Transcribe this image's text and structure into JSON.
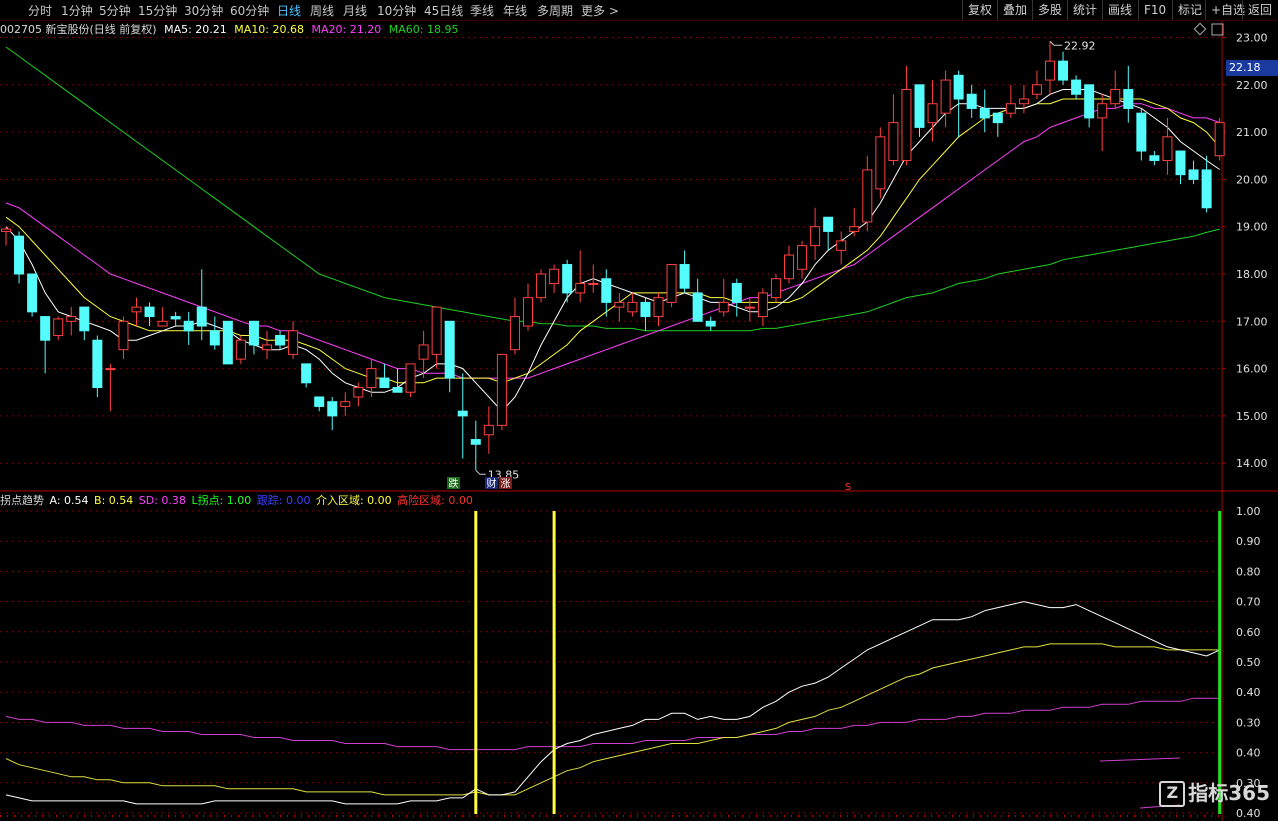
{
  "toolbar": {
    "periods": [
      "分时",
      "1分钟",
      "5分钟",
      "15分钟",
      "30分钟",
      "60分钟",
      "日线",
      "周线",
      "月线",
      "10分钟",
      "45日线",
      "季线",
      "年线",
      "多周期",
      "更多 >"
    ],
    "active_period": "日线",
    "right_buttons": [
      "复权",
      "叠加",
      "多股",
      "统计",
      "画线",
      "F10",
      "标记",
      "+自选",
      "返回"
    ]
  },
  "info": {
    "stock": "002705 新宝股份(日线 前复权)",
    "ma5": "MA5: 20.21",
    "ma10": "MA10: 20.68",
    "ma20": "MA20: 21.20",
    "ma60": "MA60: 18.95"
  },
  "colors": {
    "up": "#ff4040",
    "down": "#54fcfc",
    "ma5": "#ffffff",
    "ma10": "#ffff40",
    "ma20": "#ff40ff",
    "ma60": "#20d020",
    "grid": "#7a0000",
    "axis": "#b00000"
  },
  "price_axis": {
    "ticks": [
      "23.00",
      "22.00",
      "21.00",
      "20.00",
      "19.00",
      "18.00",
      "17.00",
      "16.00",
      "15.00",
      "14.00"
    ],
    "current": "22.18"
  },
  "annotations": {
    "high": "22.92",
    "low": "13.85",
    "flag_die": "跌",
    "flag_cai": "财",
    "flag_zhang": "涨",
    "flag_s": "S"
  },
  "indicator": {
    "name": "拐点趋势",
    "a": "A: 0.54",
    "b": "B: 0.54",
    "sd": "SD: 0.38",
    "lpoint": "L拐点: 1.00",
    "track": "跟踪: 0.00",
    "enter": "介入区域: 0.00",
    "risk": "高险区域: 0.00",
    "ticks": [
      "1.00",
      "0.90",
      "0.80",
      "0.70",
      "0.60",
      "0.50",
      "0.40",
      "0.30",
      "0.40",
      "0.30",
      "0.40"
    ]
  },
  "brand": {
    "logo": "Z",
    "text": "指标365"
  },
  "chart_data": {
    "type": "candlestick",
    "ylim": [
      13.7,
      23.2
    ],
    "candles": [
      [
        18.9,
        19.0,
        18.6,
        18.95
      ],
      [
        18.8,
        18.9,
        17.8,
        18.0
      ],
      [
        18.0,
        18.0,
        17.1,
        17.2
      ],
      [
        17.1,
        17.1,
        15.9,
        16.6
      ],
      [
        16.7,
        17.1,
        16.6,
        17.05
      ],
      [
        17.0,
        17.3,
        16.7,
        17.1
      ],
      [
        17.3,
        17.3,
        16.6,
        16.8
      ],
      [
        16.6,
        16.7,
        15.4,
        15.6
      ],
      [
        16.0,
        16.1,
        15.1,
        16.0
      ],
      [
        16.4,
        17.1,
        16.2,
        17.0
      ],
      [
        17.2,
        17.5,
        16.9,
        17.3
      ],
      [
        17.3,
        17.4,
        16.9,
        17.1
      ],
      [
        16.9,
        17.3,
        16.9,
        17.0
      ],
      [
        17.1,
        17.2,
        16.9,
        17.05
      ],
      [
        17.0,
        17.2,
        16.5,
        16.8
      ],
      [
        17.3,
        18.1,
        16.6,
        16.9
      ],
      [
        16.8,
        17.1,
        16.4,
        16.5
      ],
      [
        17.0,
        17.0,
        16.1,
        16.1
      ],
      [
        16.2,
        16.7,
        16.1,
        16.6
      ],
      [
        17.0,
        17.0,
        16.3,
        16.5
      ],
      [
        16.4,
        16.8,
        16.2,
        16.5
      ],
      [
        16.7,
        16.8,
        16.4,
        16.5
      ],
      [
        16.3,
        17.0,
        16.2,
        16.8
      ],
      [
        16.1,
        16.1,
        15.6,
        15.7
      ],
      [
        15.4,
        15.4,
        15.1,
        15.2
      ],
      [
        15.3,
        15.4,
        14.7,
        15.0
      ],
      [
        15.2,
        15.5,
        15.0,
        15.3
      ],
      [
        15.4,
        15.7,
        15.2,
        15.6
      ],
      [
        15.6,
        16.2,
        15.4,
        16.0
      ],
      [
        15.8,
        16.1,
        15.6,
        15.6
      ],
      [
        15.6,
        16.0,
        15.5,
        15.5
      ],
      [
        15.5,
        16.1,
        15.4,
        16.1
      ],
      [
        16.2,
        16.8,
        15.8,
        16.5
      ],
      [
        16.3,
        17.3,
        16.0,
        17.3
      ],
      [
        17.0,
        17.0,
        15.5,
        15.8
      ],
      [
        15.1,
        15.9,
        14.1,
        15.0
      ],
      [
        14.5,
        14.9,
        13.85,
        14.4
      ],
      [
        14.6,
        15.2,
        14.2,
        14.8
      ],
      [
        14.8,
        16.3,
        14.7,
        16.3
      ],
      [
        16.4,
        17.5,
        16.3,
        17.1
      ],
      [
        16.9,
        17.8,
        16.8,
        17.5
      ],
      [
        17.5,
        18.1,
        17.4,
        18.0
      ],
      [
        17.8,
        18.2,
        17.6,
        18.1
      ],
      [
        18.2,
        18.3,
        17.4,
        17.6
      ],
      [
        17.6,
        18.5,
        17.4,
        17.8
      ],
      [
        17.8,
        18.2,
        17.6,
        17.8
      ],
      [
        17.9,
        18.1,
        17.1,
        17.4
      ],
      [
        17.3,
        17.6,
        17.0,
        17.4
      ],
      [
        17.2,
        17.6,
        17.1,
        17.4
      ],
      [
        17.4,
        17.5,
        16.8,
        17.1
      ],
      [
        17.1,
        17.6,
        16.9,
        17.5
      ],
      [
        17.4,
        18.2,
        17.3,
        18.2
      ],
      [
        18.2,
        18.5,
        17.6,
        17.7
      ],
      [
        17.6,
        17.9,
        17.0,
        17.0
      ],
      [
        17.0,
        17.1,
        16.8,
        16.9
      ],
      [
        17.2,
        17.9,
        17.1,
        17.4
      ],
      [
        17.8,
        17.9,
        17.1,
        17.4
      ],
      [
        17.3,
        17.5,
        17.0,
        17.3
      ],
      [
        17.1,
        17.7,
        16.9,
        17.6
      ],
      [
        17.5,
        18.0,
        17.4,
        17.9
      ],
      [
        17.9,
        18.6,
        17.8,
        18.4
      ],
      [
        18.1,
        18.7,
        17.9,
        18.6
      ],
      [
        18.6,
        19.4,
        18.3,
        19.0
      ],
      [
        19.2,
        19.2,
        18.5,
        18.9
      ],
      [
        18.5,
        18.9,
        18.2,
        18.7
      ],
      [
        18.9,
        19.4,
        18.8,
        19.0
      ],
      [
        19.1,
        20.5,
        18.9,
        20.2
      ],
      [
        19.8,
        21.1,
        19.6,
        20.9
      ],
      [
        20.4,
        21.8,
        20.3,
        21.2
      ],
      [
        20.4,
        22.4,
        20.3,
        21.9
      ],
      [
        22.0,
        22.0,
        20.9,
        21.1
      ],
      [
        21.2,
        22.1,
        20.8,
        21.6
      ],
      [
        21.4,
        22.3,
        21.1,
        22.1
      ],
      [
        22.2,
        22.3,
        20.9,
        21.7
      ],
      [
        21.8,
        22.0,
        21.3,
        21.5
      ],
      [
        21.5,
        21.9,
        21.0,
        21.3
      ],
      [
        21.4,
        21.4,
        20.9,
        21.2
      ],
      [
        21.4,
        22.0,
        21.3,
        21.6
      ],
      [
        21.6,
        22.0,
        21.4,
        21.7
      ],
      [
        21.8,
        22.3,
        21.7,
        22.0
      ],
      [
        22.1,
        22.92,
        21.8,
        22.5
      ],
      [
        22.5,
        22.7,
        22.0,
        22.1
      ],
      [
        22.1,
        22.2,
        21.7,
        21.8
      ],
      [
        22.0,
        22.0,
        21.1,
        21.3
      ],
      [
        21.3,
        21.8,
        20.6,
        21.6
      ],
      [
        21.6,
        22.3,
        21.5,
        21.9
      ],
      [
        21.9,
        22.4,
        21.2,
        21.5
      ],
      [
        21.4,
        21.5,
        20.4,
        20.6
      ],
      [
        20.5,
        20.6,
        20.3,
        20.4
      ],
      [
        20.4,
        21.3,
        20.1,
        20.9
      ],
      [
        20.6,
        20.6,
        19.9,
        20.1
      ],
      [
        20.2,
        20.4,
        19.9,
        20.0
      ],
      [
        20.2,
        20.5,
        19.3,
        19.4
      ],
      [
        20.5,
        21.3,
        20.4,
        21.2
      ]
    ],
    "ma5": [
      19.0,
      18.7,
      18.2,
      17.6,
      17.2,
      17.1,
      17.0,
      16.9,
      16.8,
      16.6,
      16.6,
      16.7,
      16.8,
      16.9,
      16.9,
      17.0,
      16.9,
      16.8,
      16.6,
      16.5,
      16.4,
      16.4,
      16.5,
      16.4,
      16.2,
      15.9,
      15.7,
      15.6,
      15.5,
      15.5,
      15.6,
      15.8,
      15.9,
      16.1,
      16.1,
      16.0,
      15.7,
      15.4,
      15.1,
      15.4,
      15.9,
      16.5,
      17.0,
      17.5,
      17.8,
      17.9,
      17.8,
      17.7,
      17.6,
      17.5,
      17.4,
      17.5,
      17.6,
      17.5,
      17.4,
      17.4,
      17.3,
      17.2,
      17.2,
      17.3,
      17.5,
      17.8,
      18.2,
      18.5,
      18.7,
      18.9,
      19.1,
      19.5,
      20.0,
      20.5,
      20.8,
      21.1,
      21.4,
      21.6,
      21.6,
      21.5,
      21.5,
      21.5,
      21.5,
      21.6,
      21.8,
      21.9,
      21.9,
      21.9,
      21.8,
      21.7,
      21.6,
      21.5,
      21.3,
      21.1,
      20.8,
      20.6,
      20.4,
      20.21
    ],
    "ma10": [
      19.2,
      19.0,
      18.7,
      18.4,
      18.1,
      17.8,
      17.5,
      17.3,
      17.1,
      17.0,
      16.9,
      16.8,
      16.8,
      16.8,
      16.8,
      16.8,
      16.8,
      16.8,
      16.7,
      16.7,
      16.6,
      16.6,
      16.6,
      16.5,
      16.4,
      16.2,
      16.0,
      15.9,
      15.8,
      15.8,
      15.7,
      15.7,
      15.7,
      15.8,
      15.8,
      15.8,
      15.8,
      15.8,
      15.7,
      15.8,
      15.9,
      16.1,
      16.3,
      16.5,
      16.8,
      17.0,
      17.2,
      17.4,
      17.6,
      17.6,
      17.6,
      17.6,
      17.6,
      17.6,
      17.5,
      17.5,
      17.4,
      17.4,
      17.4,
      17.4,
      17.4,
      17.5,
      17.7,
      17.9,
      18.1,
      18.3,
      18.5,
      18.8,
      19.2,
      19.6,
      20.0,
      20.3,
      20.6,
      20.9,
      21.1,
      21.3,
      21.4,
      21.5,
      21.5,
      21.6,
      21.6,
      21.7,
      21.7,
      21.7,
      21.7,
      21.7,
      21.7,
      21.7,
      21.6,
      21.5,
      21.3,
      21.2,
      21.0,
      20.68
    ],
    "ma20": [
      19.5,
      19.4,
      19.2,
      19.0,
      18.8,
      18.6,
      18.4,
      18.2,
      18.0,
      17.9,
      17.8,
      17.7,
      17.6,
      17.5,
      17.4,
      17.3,
      17.2,
      17.1,
      17.0,
      16.9,
      16.9,
      16.8,
      16.8,
      16.7,
      16.6,
      16.5,
      16.4,
      16.3,
      16.2,
      16.1,
      16.0,
      16.0,
      15.9,
      15.9,
      15.9,
      15.8,
      15.8,
      15.8,
      15.8,
      15.8,
      15.8,
      15.9,
      16.0,
      16.1,
      16.2,
      16.3,
      16.4,
      16.5,
      16.6,
      16.7,
      16.8,
      16.9,
      17.0,
      17.1,
      17.2,
      17.3,
      17.4,
      17.5,
      17.5,
      17.6,
      17.7,
      17.8,
      17.9,
      18.0,
      18.1,
      18.2,
      18.4,
      18.6,
      18.8,
      19.0,
      19.2,
      19.4,
      19.6,
      19.8,
      20.0,
      20.2,
      20.4,
      20.6,
      20.8,
      20.9,
      21.1,
      21.2,
      21.3,
      21.4,
      21.5,
      21.5,
      21.6,
      21.6,
      21.5,
      21.5,
      21.4,
      21.3,
      21.3,
      21.2
    ],
    "ma60": [
      22.8,
      22.6,
      22.4,
      22.2,
      22.0,
      21.8,
      21.6,
      21.4,
      21.2,
      21.0,
      20.8,
      20.6,
      20.4,
      20.2,
      20.0,
      19.8,
      19.6,
      19.4,
      19.2,
      19.0,
      18.8,
      18.6,
      18.4,
      18.2,
      18.0,
      17.9,
      17.8,
      17.7,
      17.6,
      17.5,
      17.45,
      17.4,
      17.35,
      17.3,
      17.25,
      17.2,
      17.15,
      17.1,
      17.05,
      17.0,
      17.0,
      16.95,
      16.95,
      16.9,
      16.9,
      16.9,
      16.85,
      16.85,
      16.85,
      16.8,
      16.8,
      16.8,
      16.8,
      16.8,
      16.8,
      16.8,
      16.8,
      16.8,
      16.85,
      16.85,
      16.9,
      16.95,
      17.0,
      17.05,
      17.1,
      17.15,
      17.2,
      17.3,
      17.4,
      17.5,
      17.55,
      17.6,
      17.7,
      17.8,
      17.85,
      17.9,
      18.0,
      18.05,
      18.1,
      18.15,
      18.2,
      18.3,
      18.35,
      18.4,
      18.45,
      18.5,
      18.55,
      18.6,
      18.65,
      18.7,
      18.75,
      18.8,
      18.88,
      18.95
    ],
    "ind_white": [
      0.06,
      0.05,
      0.04,
      0.04,
      0.04,
      0.04,
      0.04,
      0.04,
      0.04,
      0.04,
      0.03,
      0.03,
      0.03,
      0.03,
      0.03,
      0.03,
      0.04,
      0.04,
      0.04,
      0.04,
      0.04,
      0.04,
      0.04,
      0.04,
      0.04,
      0.04,
      0.03,
      0.03,
      0.03,
      0.03,
      0.03,
      0.04,
      0.04,
      0.04,
      0.05,
      0.05,
      0.08,
      0.06,
      0.06,
      0.07,
      0.12,
      0.17,
      0.21,
      0.23,
      0.24,
      0.26,
      0.27,
      0.28,
      0.29,
      0.31,
      0.31,
      0.33,
      0.33,
      0.31,
      0.32,
      0.31,
      0.31,
      0.32,
      0.35,
      0.37,
      0.4,
      0.42,
      0.43,
      0.45,
      0.48,
      0.51,
      0.54,
      0.56,
      0.58,
      0.6,
      0.62,
      0.64,
      0.64,
      0.64,
      0.65,
      0.67,
      0.68,
      0.69,
      0.7,
      0.69,
      0.68,
      0.68,
      0.69,
      0.67,
      0.65,
      0.63,
      0.61,
      0.59,
      0.57,
      0.55,
      0.54,
      0.53,
      0.52,
      0.54
    ],
    "ind_yellow": [
      0.18,
      0.16,
      0.15,
      0.14,
      0.13,
      0.12,
      0.12,
      0.11,
      0.11,
      0.1,
      0.1,
      0.1,
      0.09,
      0.09,
      0.09,
      0.09,
      0.09,
      0.08,
      0.08,
      0.08,
      0.08,
      0.08,
      0.08,
      0.07,
      0.07,
      0.07,
      0.07,
      0.07,
      0.07,
      0.06,
      0.06,
      0.06,
      0.06,
      0.06,
      0.06,
      0.06,
      0.07,
      0.06,
      0.06,
      0.06,
      0.08,
      0.1,
      0.12,
      0.14,
      0.15,
      0.17,
      0.18,
      0.19,
      0.2,
      0.21,
      0.22,
      0.23,
      0.23,
      0.23,
      0.24,
      0.25,
      0.25,
      0.26,
      0.27,
      0.28,
      0.3,
      0.31,
      0.32,
      0.34,
      0.35,
      0.37,
      0.39,
      0.41,
      0.43,
      0.45,
      0.46,
      0.48,
      0.49,
      0.5,
      0.51,
      0.52,
      0.53,
      0.54,
      0.55,
      0.55,
      0.56,
      0.56,
      0.56,
      0.56,
      0.56,
      0.55,
      0.55,
      0.55,
      0.55,
      0.54,
      0.54,
      0.54,
      0.54,
      0.54
    ],
    "ind_magenta": [
      0.32,
      0.31,
      0.31,
      0.3,
      0.3,
      0.3,
      0.29,
      0.29,
      0.29,
      0.28,
      0.28,
      0.28,
      0.27,
      0.27,
      0.27,
      0.26,
      0.26,
      0.26,
      0.26,
      0.25,
      0.25,
      0.25,
      0.24,
      0.24,
      0.24,
      0.24,
      0.23,
      0.23,
      0.23,
      0.23,
      0.22,
      0.22,
      0.22,
      0.22,
      0.21,
      0.21,
      0.21,
      0.21,
      0.21,
      0.21,
      0.22,
      0.22,
      0.22,
      0.22,
      0.22,
      0.23,
      0.23,
      0.23,
      0.23,
      0.24,
      0.24,
      0.24,
      0.24,
      0.25,
      0.25,
      0.25,
      0.25,
      0.26,
      0.26,
      0.26,
      0.27,
      0.27,
      0.28,
      0.28,
      0.28,
      0.29,
      0.29,
      0.3,
      0.3,
      0.3,
      0.31,
      0.31,
      0.31,
      0.32,
      0.32,
      0.33,
      0.33,
      0.33,
      0.34,
      0.34,
      0.34,
      0.35,
      0.35,
      0.35,
      0.36,
      0.36,
      0.36,
      0.37,
      0.37,
      0.37,
      0.37,
      0.38,
      0.38,
      0.38
    ],
    "yellow_bars": [
      36,
      42
    ],
    "green_bar": 93
  }
}
